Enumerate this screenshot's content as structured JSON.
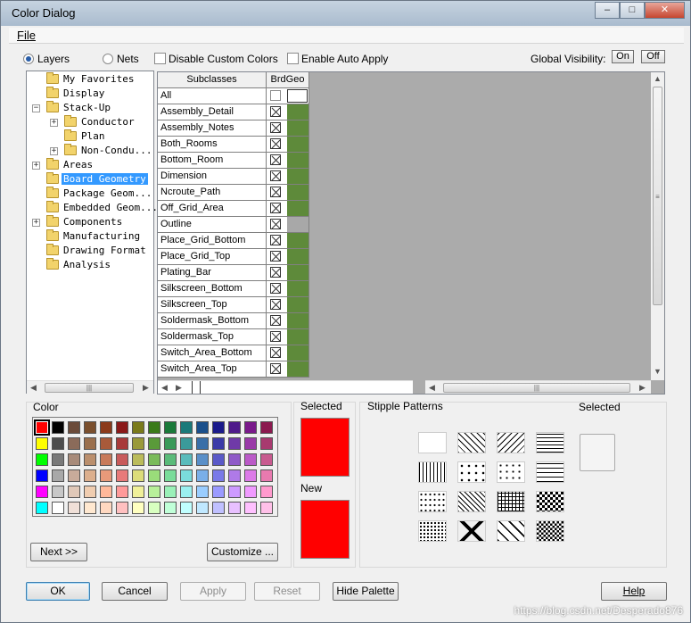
{
  "window": {
    "title": "Color Dialog",
    "caption_min": "–",
    "caption_max": "□",
    "caption_close": "✕"
  },
  "menu": {
    "file": "File"
  },
  "options": {
    "layers_label": "Layers",
    "nets_label": "Nets",
    "disable_custom_colors": "Disable Custom Colors",
    "enable_auto_apply": "Enable Auto Apply",
    "global_visibility": "Global Visibility:",
    "on_label": "On",
    "off_label": "Off"
  },
  "tree": {
    "items": [
      {
        "label": "My Favorites",
        "indent": 0,
        "expander": ""
      },
      {
        "label": "Display",
        "indent": 0,
        "expander": ""
      },
      {
        "label": "Stack-Up",
        "indent": 0,
        "expander": "−"
      },
      {
        "label": "Conductor",
        "indent": 1,
        "expander": "+"
      },
      {
        "label": "Plan",
        "indent": 1,
        "expander": ""
      },
      {
        "label": "Non-Condu...",
        "indent": 1,
        "expander": "+"
      },
      {
        "label": "Areas",
        "indent": 0,
        "expander": "+"
      },
      {
        "label": "Board Geometry",
        "indent": 0,
        "expander": "",
        "selected": true
      },
      {
        "label": "Package Geom...",
        "indent": 0,
        "expander": ""
      },
      {
        "label": "Embedded Geom...",
        "indent": 0,
        "expander": ""
      },
      {
        "label": "Components",
        "indent": 0,
        "expander": "+"
      },
      {
        "label": "Manufacturing",
        "indent": 0,
        "expander": ""
      },
      {
        "label": "Drawing Format",
        "indent": 0,
        "expander": ""
      },
      {
        "label": "Analysis",
        "indent": 0,
        "expander": ""
      }
    ]
  },
  "grid": {
    "col_subclasses": "Subclasses",
    "col_brdgeo": "BrdGeo",
    "all_label": "All",
    "rows": [
      {
        "name": "Assembly_Detail",
        "color": "#5e8a3a"
      },
      {
        "name": "Assembly_Notes",
        "color": "#5e8a3a"
      },
      {
        "name": "Both_Rooms",
        "color": "#5e8a3a"
      },
      {
        "name": "Bottom_Room",
        "color": "#5e8a3a"
      },
      {
        "name": "Dimension",
        "color": "#5e8a3a"
      },
      {
        "name": "Ncroute_Path",
        "color": "#5e8a3a"
      },
      {
        "name": "Off_Grid_Area",
        "color": "#5e8a3a"
      },
      {
        "name": "Outline",
        "color": "#a8a8a8"
      },
      {
        "name": "Place_Grid_Bottom",
        "color": "#5e8a3a"
      },
      {
        "name": "Place_Grid_Top",
        "color": "#5e8a3a"
      },
      {
        "name": "Plating_Bar",
        "color": "#5e8a3a"
      },
      {
        "name": "Silkscreen_Bottom",
        "color": "#5e8a3a"
      },
      {
        "name": "Silkscreen_Top",
        "color": "#5e8a3a"
      },
      {
        "name": "Soldermask_Bottom",
        "color": "#5e8a3a"
      },
      {
        "name": "Soldermask_Top",
        "color": "#5e8a3a"
      },
      {
        "name": "Switch_Area_Bottom",
        "color": "#5e8a3a"
      },
      {
        "name": "Switch_Area_Top",
        "color": "#5e8a3a"
      }
    ]
  },
  "color_panel": {
    "title": "Color",
    "next_button": "Next >>",
    "customize_button": "Customize ...",
    "palette": [
      [
        "#ff0000",
        "#000000",
        "#6b4b3a",
        "#7a4f2d",
        "#8b3a1a",
        "#8b1a1a",
        "#7a7a1a",
        "#3a7a1a",
        "#1a7a3a",
        "#1a7a7a",
        "#1a4f8b",
        "#1a1a8b",
        "#4f1a8b",
        "#7a1a8b",
        "#8b1a4f"
      ],
      [
        "#ffff00",
        "#4d4d4d",
        "#8b6b5a",
        "#9a6f4d",
        "#a85a3a",
        "#a83a3a",
        "#9a9a3a",
        "#5a9a3a",
        "#3a9a5a",
        "#3a9a9a",
        "#3a6fa8",
        "#3a3aa8",
        "#6f3aa8",
        "#9a3aa8",
        "#a83a6f"
      ],
      [
        "#00ff00",
        "#7a7a7a",
        "#a88b7a",
        "#bb8f6d",
        "#c87a5a",
        "#c85a5a",
        "#bbbb5a",
        "#7abb5a",
        "#5abb7a",
        "#5abbbb",
        "#5a8fc8",
        "#5a5ac8",
        "#8f5ac8",
        "#bb5ac8",
        "#c85a8f"
      ],
      [
        "#0000ff",
        "#a8a8a8",
        "#c8ab9a",
        "#dcaf8d",
        "#e89a7a",
        "#e87a7a",
        "#dcdc7a",
        "#9adc7a",
        "#7adc9a",
        "#7adcdc",
        "#7aafe8",
        "#7a7ae8",
        "#af7ae8",
        "#dc7ae8",
        "#e87aaf"
      ],
      [
        "#ff00ff",
        "#c8c8c8",
        "#e0c8b8",
        "#f0cdb0",
        "#ffb89a",
        "#ff9a9a",
        "#f0f09a",
        "#b8f09a",
        "#9af0b8",
        "#9af0f0",
        "#9acdff",
        "#9a9aff",
        "#cd9aff",
        "#f09aff",
        "#ff9acd"
      ],
      [
        "#00ffff",
        "#ffffff",
        "#f0e0d8",
        "#ffe8d0",
        "#ffd8c0",
        "#ffc0c0",
        "#ffffc0",
        "#d8ffc0",
        "#c0ffd8",
        "#c0ffff",
        "#c0e8ff",
        "#c0c0ff",
        "#e8c0ff",
        "#ffc0ff",
        "#ffc0e8"
      ]
    ]
  },
  "selected_panel": {
    "selected_label": "Selected",
    "new_label": "New",
    "selected_color": "#ff0000",
    "new_color": "#ff0000"
  },
  "stipple_panel": {
    "title": "Stipple Patterns",
    "selected_label": "Selected"
  },
  "buttons": {
    "ok": "OK",
    "cancel": "Cancel",
    "apply": "Apply",
    "reset": "Reset",
    "hide_palette": "Hide Palette",
    "help": "Help"
  },
  "watermark": "https://blog.csdn.net/Desperado876"
}
